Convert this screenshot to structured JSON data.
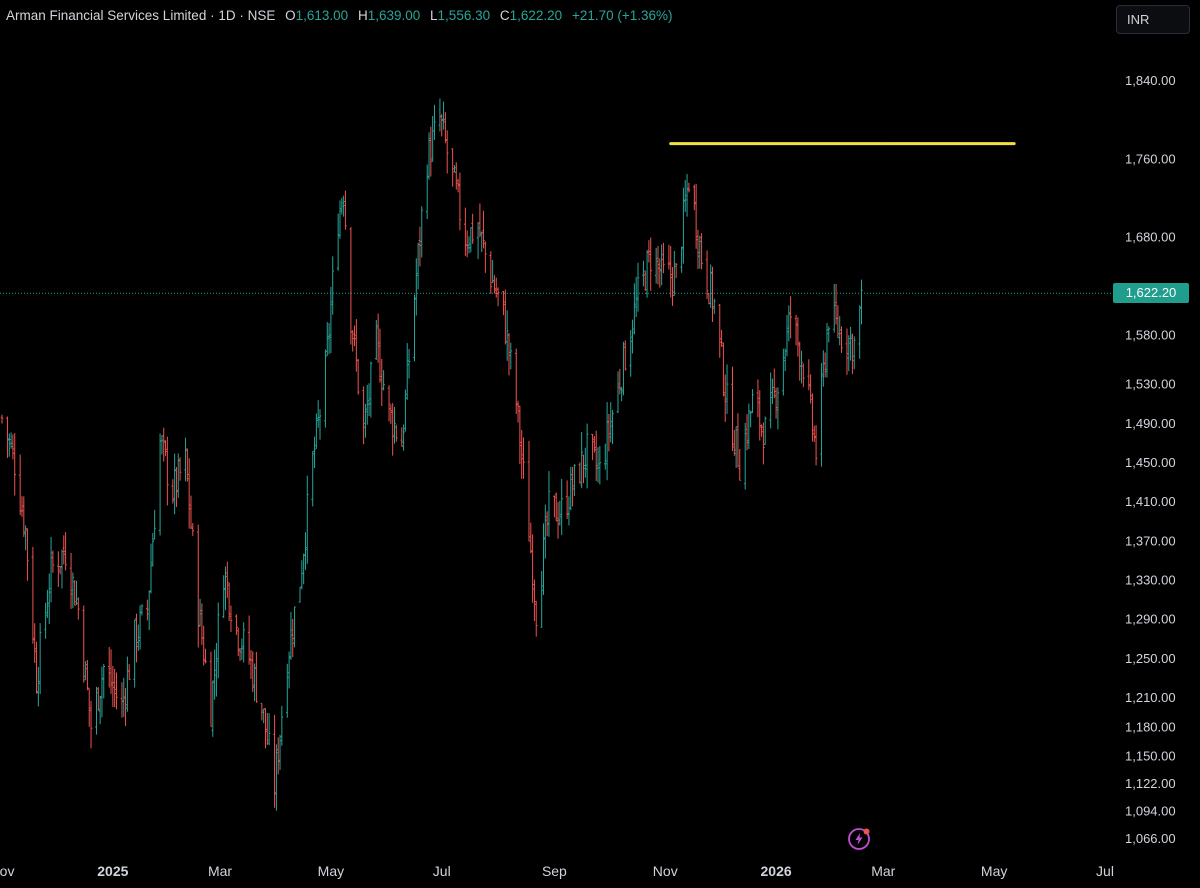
{
  "legend": {
    "symbol": "Arman Financial Services Limited · 1D · NSE",
    "open_label": "O",
    "open": "1,613.00",
    "high_label": "H",
    "high": "1,639.00",
    "low_label": "L",
    "low": "1,556.30",
    "close_label": "C",
    "close": "1,622.20",
    "change": "+21.70 (+1.36%)"
  },
  "currency": "INR",
  "last_price": "1,622.20",
  "colors": {
    "up": "#26a69a",
    "down": "#ef5350",
    "trendline": "#f5e13b",
    "background": "#000000"
  },
  "icons": {
    "alert": "lightning-alert-icon"
  },
  "chart_data": {
    "type": "bar",
    "style": "ohlc-bars",
    "ylim": [
      1050,
      1880
    ],
    "y_ticks": [
      "1,840.00",
      "1,760.00",
      "1,680.00",
      "1,580.00",
      "1,530.00",
      "1,490.00",
      "1,450.00",
      "1,410.00",
      "1,370.00",
      "1,330.00",
      "1,290.00",
      "1,250.00",
      "1,210.00",
      "1,180.00",
      "1,150.00",
      "1,122.00",
      "1,094.00",
      "1,066.00"
    ],
    "y_tick_values": [
      1840,
      1760,
      1680,
      1580,
      1530,
      1490,
      1450,
      1410,
      1370,
      1330,
      1290,
      1250,
      1210,
      1180,
      1150,
      1122,
      1094,
      1066
    ],
    "x_ticks": [
      {
        "label": "Nov",
        "date": "2024-11-01",
        "year": false
      },
      {
        "label": "2025",
        "date": "2025-01-01",
        "year": true
      },
      {
        "label": "Mar",
        "date": "2025-03-01",
        "year": false
      },
      {
        "label": "May",
        "date": "2025-05-01",
        "year": false
      },
      {
        "label": "Jul",
        "date": "2025-07-01",
        "year": false
      },
      {
        "label": "Sep",
        "date": "2025-09-01",
        "year": false
      },
      {
        "label": "Nov",
        "date": "2025-11-01",
        "year": false
      },
      {
        "label": "2026",
        "date": "2026-01-01",
        "year": true
      },
      {
        "label": "Mar",
        "date": "2026-03-01",
        "year": false
      },
      {
        "label": "May",
        "date": "2026-05-01",
        "year": false
      },
      {
        "label": "Jul",
        "date": "2026-07-01",
        "year": false
      }
    ],
    "x_range": [
      "2024-11-01",
      "2026-07-01"
    ],
    "series": [
      {
        "kind": "close-anchors",
        "points": [
          [
            "2024-11-01",
            1495
          ],
          [
            "2024-11-08",
            1450
          ],
          [
            "2024-11-14",
            1380
          ],
          [
            "2024-11-20",
            1230
          ],
          [
            "2024-11-28",
            1340
          ],
          [
            "2024-12-06",
            1360
          ],
          [
            "2024-12-13",
            1300
          ],
          [
            "2024-12-20",
            1180
          ],
          [
            "2024-12-27",
            1240
          ],
          [
            "2025-01-06",
            1200
          ],
          [
            "2025-01-13",
            1270
          ],
          [
            "2025-01-20",
            1300
          ],
          [
            "2025-01-27",
            1470
          ],
          [
            "2025-02-03",
            1420
          ],
          [
            "2025-02-10",
            1450
          ],
          [
            "2025-02-17",
            1300
          ],
          [
            "2025-02-24",
            1200
          ],
          [
            "2025-03-03",
            1340
          ],
          [
            "2025-03-10",
            1280
          ],
          [
            "2025-03-17",
            1250
          ],
          [
            "2025-03-24",
            1200
          ],
          [
            "2025-03-31",
            1120
          ],
          [
            "2025-04-07",
            1250
          ],
          [
            "2025-04-14",
            1330
          ],
          [
            "2025-04-21",
            1450
          ],
          [
            "2025-04-28",
            1540
          ],
          [
            "2025-05-05",
            1700
          ],
          [
            "2025-05-08",
            1730
          ],
          [
            "2025-05-12",
            1600
          ],
          [
            "2025-05-19",
            1480
          ],
          [
            "2025-05-26",
            1570
          ],
          [
            "2025-06-02",
            1500
          ],
          [
            "2025-06-09",
            1470
          ],
          [
            "2025-06-16",
            1620
          ],
          [
            "2025-06-23",
            1760
          ],
          [
            "2025-06-30",
            1800
          ],
          [
            "2025-07-07",
            1740
          ],
          [
            "2025-07-14",
            1680
          ],
          [
            "2025-07-21",
            1690
          ],
          [
            "2025-07-28",
            1640
          ],
          [
            "2025-08-04",
            1600
          ],
          [
            "2025-08-11",
            1510
          ],
          [
            "2025-08-18",
            1380
          ],
          [
            "2025-08-22",
            1300
          ],
          [
            "2025-08-29",
            1400
          ],
          [
            "2025-09-05",
            1400
          ],
          [
            "2025-09-12",
            1430
          ],
          [
            "2025-09-19",
            1460
          ],
          [
            "2025-09-26",
            1440
          ],
          [
            "2025-10-03",
            1500
          ],
          [
            "2025-10-10",
            1560
          ],
          [
            "2025-10-17",
            1620
          ],
          [
            "2025-10-24",
            1660
          ],
          [
            "2025-10-31",
            1640
          ],
          [
            "2025-11-07",
            1640
          ],
          [
            "2025-11-14",
            1740
          ],
          [
            "2025-11-21",
            1660
          ],
          [
            "2025-11-28",
            1610
          ],
          [
            "2025-12-05",
            1510
          ],
          [
            "2025-12-12",
            1450
          ],
          [
            "2025-12-19",
            1510
          ],
          [
            "2025-12-26",
            1480
          ],
          [
            "2026-01-02",
            1530
          ],
          [
            "2026-01-09",
            1600
          ],
          [
            "2026-01-16",
            1550
          ],
          [
            "2026-01-23",
            1460
          ],
          [
            "2026-01-30",
            1600
          ],
          [
            "2026-02-06",
            1580
          ],
          [
            "2026-02-13",
            1570
          ],
          [
            "2026-02-18",
            1622.2
          ]
        ]
      }
    ],
    "trendline": {
      "from": [
        "2025-11-04",
        1775
      ],
      "to": [
        "2026-05-12",
        1775
      ]
    },
    "last_price": 1622.2
  }
}
